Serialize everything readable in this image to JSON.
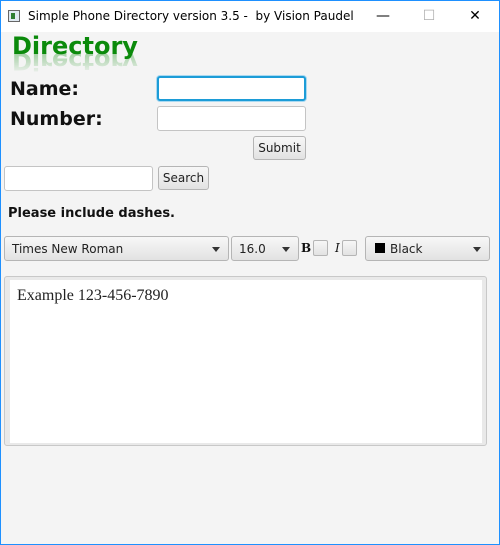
{
  "window": {
    "title": "Simple Phone Directory version 3.5 -  by Vision Paudel",
    "controls": {
      "minimize": "—",
      "maximize": "☐",
      "close": "✕"
    }
  },
  "header": {
    "title": "Directory"
  },
  "form": {
    "name_label": "Name:",
    "name_value": "",
    "number_label": "Number:",
    "number_value": "",
    "submit_label": "Submit"
  },
  "search": {
    "value": "",
    "button_label": "Search"
  },
  "hint": "Please include dashes.",
  "toolbar": {
    "font_family": "Times New Roman",
    "font_size": "16.0",
    "bold_label": "B",
    "italic_label": "I",
    "color_name": "Black",
    "color_value": "#000000"
  },
  "editor": {
    "text": "Example 123-456-7890"
  },
  "colors": {
    "accent": "#0b8a0b",
    "focus": "#1c9cd7",
    "window_border": "#1e90ff"
  }
}
